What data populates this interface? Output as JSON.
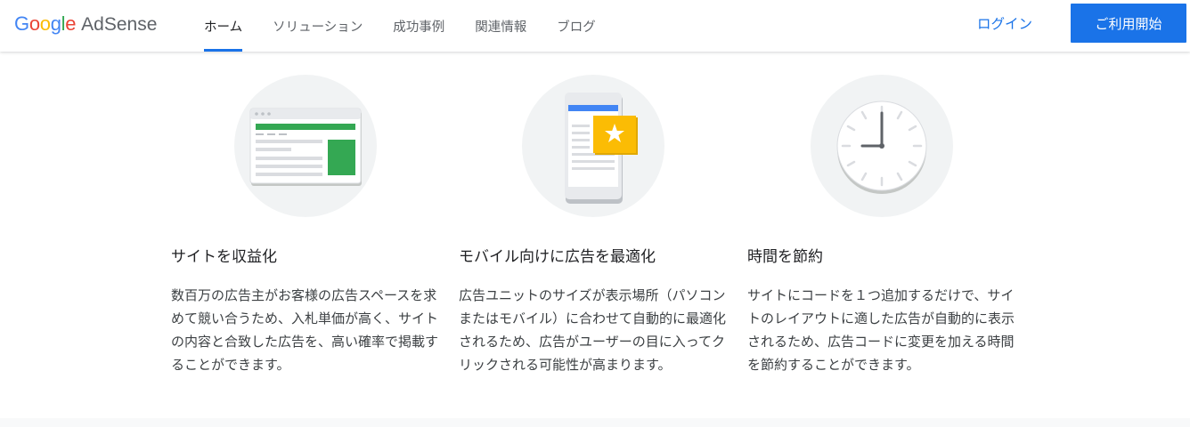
{
  "header": {
    "logo": {
      "google": [
        "G",
        "o",
        "o",
        "g",
        "l",
        "e"
      ],
      "google_colors": [
        "#4285F4",
        "#EA4335",
        "#FBBC05",
        "#4285F4",
        "#34A853",
        "#EA4335"
      ],
      "product": "AdSense"
    },
    "nav": [
      {
        "label": "ホーム",
        "active": true
      },
      {
        "label": "ソリューション"
      },
      {
        "label": "成功事例"
      },
      {
        "label": "関連情報"
      },
      {
        "label": "ブログ"
      }
    ],
    "login_label": "ログイン",
    "cta_label": "ご利用開始"
  },
  "features": [
    {
      "icon": "browser-window-icon",
      "title": "サイトを収益化",
      "body": "数百万の広告主がお客様の広告スペースを求めて競い合うため、入札単価が高く、サイトの内容と合致した広告を、高い確率で掲載することができます。"
    },
    {
      "icon": "mobile-star-icon",
      "title": "モバイル向けに広告を最適化",
      "body": "広告ユニットのサイズが表示場所（パソコンまたはモバイル）に合わせて自動的に最適化されるため、広告がユーザーの目に入ってクリックされる可能性が高まります。"
    },
    {
      "icon": "clock-icon",
      "title": "時間を節約",
      "body": "サイトにコードを１つ追加するだけで、サイトのレイアウトに適した広告が自動的に表示されるため、広告コードに変更を加える時間を節約することができます。"
    }
  ],
  "colors": {
    "accent": "#1a73e8",
    "green": "#34a853",
    "yellow": "#fbbc04"
  }
}
